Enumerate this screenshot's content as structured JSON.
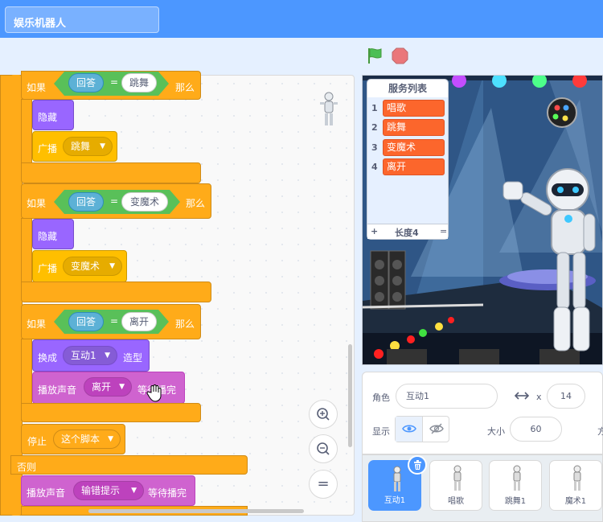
{
  "project": {
    "title": "娱乐机器人"
  },
  "controls": {
    "green_flag": "green-flag-icon",
    "stop": "stop-icon"
  },
  "script": {
    "if1": {
      "kw_if": "如果",
      "reporter": "回答",
      "eq": "=",
      "value": "跳舞",
      "kw_then": "那么"
    },
    "hide1": "隐藏",
    "broadcast1": {
      "label": "广播",
      "message": "跳舞"
    },
    "if2": {
      "kw_if": "如果",
      "reporter": "回答",
      "eq": "=",
      "value": "变魔术",
      "kw_then": "那么"
    },
    "hide2": "隐藏",
    "broadcast2": {
      "label": "广播",
      "message": "变魔术"
    },
    "if3": {
      "kw_if": "如果",
      "reporter": "回答",
      "eq": "=",
      "value": "离开",
      "kw_then": "那么"
    },
    "switch_costume": {
      "label": "换成",
      "costume": "互动1",
      "suffix": "造型"
    },
    "play_sound1": {
      "label": "播放声音",
      "sound": "离开",
      "suffix": "等待播完"
    },
    "stop": {
      "label": "停止",
      "option": "这个脚本"
    },
    "else": "否则",
    "play_sound2": {
      "label": "播放声音",
      "sound": "输错提示",
      "suffix": "等待播完"
    }
  },
  "zoom": {
    "in": "+",
    "out": "−",
    "reset": "="
  },
  "list_monitor": {
    "title": "服务列表",
    "items": [
      "唱歌",
      "跳舞",
      "变魔术",
      "离开"
    ],
    "indices": [
      "1",
      "2",
      "3",
      "4"
    ],
    "add": "+",
    "length_label": "长度4",
    "resize": "="
  },
  "sprite_info": {
    "sprite_label": "角色",
    "sprite_name": "互动1",
    "x_label": "x",
    "x_value": "14",
    "show_label": "显示",
    "size_label": "大小",
    "size_value": "60",
    "direction_label_partial": "方"
  },
  "sprites": [
    {
      "name": "互动1",
      "selected": true
    },
    {
      "name": "唱歌",
      "selected": false
    },
    {
      "name": "跳舞1",
      "selected": false
    },
    {
      "name": "魔术1",
      "selected": false
    }
  ],
  "colors": {
    "menu_bar": "#4c97ff",
    "control": "#ffab19",
    "looks": "#9966ff",
    "events": "#ffbf00",
    "sound": "#cf63cf",
    "operators": "#59c059",
    "sensing": "#5cb1d6",
    "list": "#fc662c"
  }
}
